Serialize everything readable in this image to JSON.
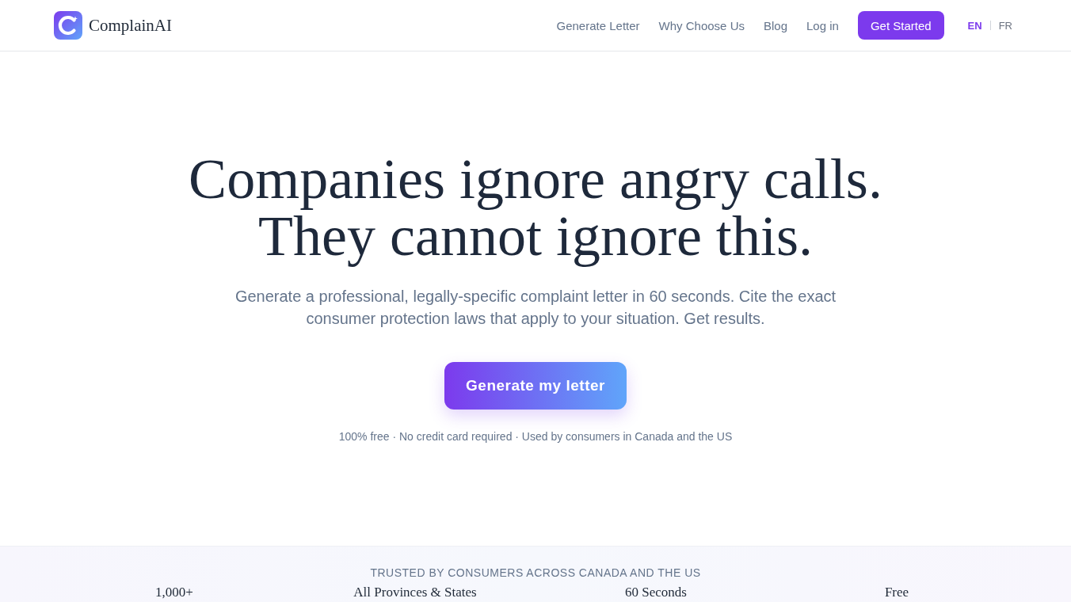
{
  "header": {
    "brand": "ComplainAI",
    "nav": [
      "Generate Letter",
      "Why Choose Us",
      "Blog",
      "Log in"
    ],
    "cta": "Get Started",
    "languages": [
      {
        "label": "EN",
        "selected": true
      },
      {
        "label": "FR",
        "selected": false
      }
    ]
  },
  "hero": {
    "headline": "Companies ignore angry calls. They cannot ignore this.",
    "subtitle": "Generate a professional, legally-specific complaint letter in 60 seconds. Cite the exact consumer protection laws that apply to your situation. Get results.",
    "button": "Generate my letter",
    "note": "100% free · No credit card required · Used by consumers in Canada and the US"
  },
  "trust": {
    "heading": "TRUSTED BY CONSUMERS ACROSS CANADA AND THE US",
    "stats": [
      "1,000+",
      "All Provinces & States",
      "60 Seconds",
      "Free"
    ]
  }
}
